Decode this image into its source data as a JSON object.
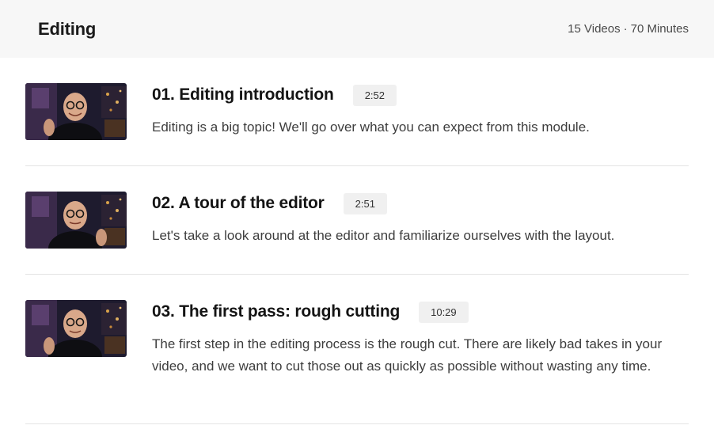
{
  "header": {
    "title": "Editing",
    "video_count": "15 Videos",
    "separator": "·",
    "total_time": "70 Minutes"
  },
  "lessons": [
    {
      "title": "01. Editing introduction",
      "duration": "2:52",
      "description": "Editing is a big topic! We'll go over what you can expect from this module."
    },
    {
      "title": "02. A tour of the editor",
      "duration": "2:51",
      "description": "Let's take a look around at the editor and familiarize ourselves with the layout."
    },
    {
      "title": "03. The first pass: rough cutting",
      "duration": "10:29",
      "description": "The first step in the editing process is the rough cut. There are likely bad takes in your video, and we want to cut those out as quickly as possible without wasting any time."
    }
  ],
  "colors": {
    "header_bg": "#f7f7f7",
    "duration_bg": "#f0f0f0",
    "divider": "#e4e4e4"
  }
}
